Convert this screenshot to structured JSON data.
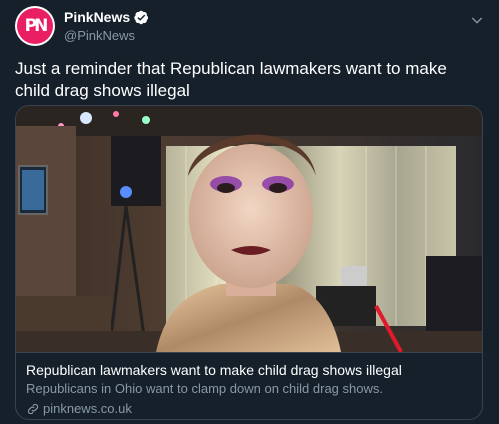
{
  "account": {
    "display_name": "PinkNews",
    "handle": "@PinkNews",
    "avatar_text": "PN"
  },
  "tweet": {
    "text": "Just a reminder that Republican lawmakers want to make child drag shows illegal"
  },
  "card": {
    "title": "Republican lawmakers want to make child drag shows illegal",
    "description": "Republicans in Ohio want to clamp down on child drag shows.",
    "domain": "pinknews.co.uk"
  },
  "icons": {
    "verified": "verified-badge-icon",
    "caret": "chevron-down-icon",
    "link": "link-icon"
  },
  "colors": {
    "background": "#15202b",
    "brand": "#e91e63",
    "verified": "#1da1f2",
    "muted_text": "#8899a6"
  }
}
